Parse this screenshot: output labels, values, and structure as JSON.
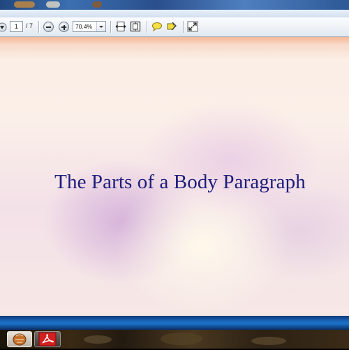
{
  "toolbar": {
    "page_current": "1",
    "page_total": "/ 7",
    "zoom": "70.4%"
  },
  "slide": {
    "title": "The Parts of a Body Paragraph"
  },
  "icons": {
    "nav_down": "arrow-down-icon",
    "zoom_out": "zoom-out-icon",
    "zoom_in": "zoom-in-icon",
    "fit_width": "fit-width-icon",
    "fit_page": "fit-page-icon",
    "comment": "comment-icon",
    "highlight": "highlight-icon",
    "expand": "expand-icon",
    "taskbar_app_1": "baseball-glove-icon",
    "taskbar_app_2": "adobe-reader-icon"
  },
  "colors": {
    "title_text": "#1d1d7a",
    "taskbar_blue": "#1b73c8",
    "reader_red": "#d21f1f"
  }
}
